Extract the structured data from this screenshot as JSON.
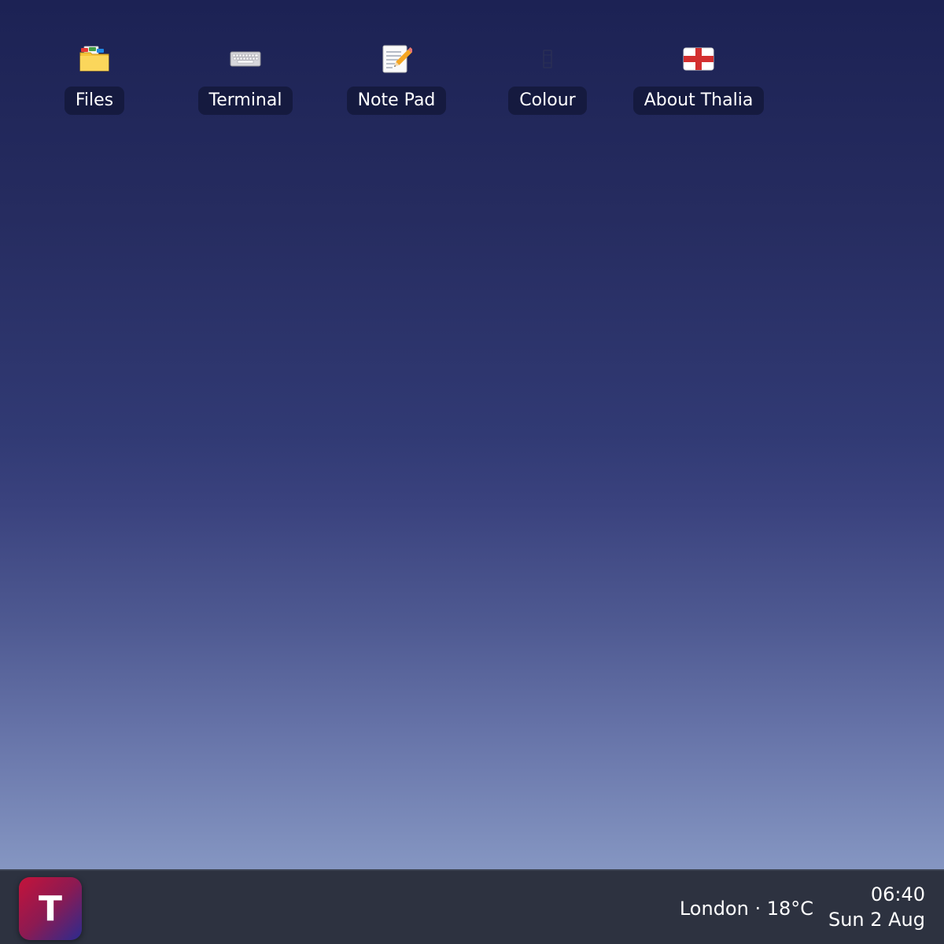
{
  "desktop": {
    "icons": [
      {
        "label": "Files",
        "icon": "folder-icon"
      },
      {
        "label": "Terminal",
        "icon": "keyboard-icon"
      },
      {
        "label": "Note Pad",
        "icon": "notepad-icon"
      },
      {
        "label": "Colour",
        "icon": "colour-icon"
      },
      {
        "label": "About Thalia",
        "icon": "england-flag-icon"
      }
    ]
  },
  "taskbar": {
    "start_label": "T",
    "weather": "London · 18°C",
    "time": "06:40",
    "date": "Sun 2 Aug"
  },
  "colors": {
    "taskbar_bg": "#2d3240",
    "start_gradient_from": "#c5133a",
    "start_gradient_to": "#2b2b8f"
  }
}
